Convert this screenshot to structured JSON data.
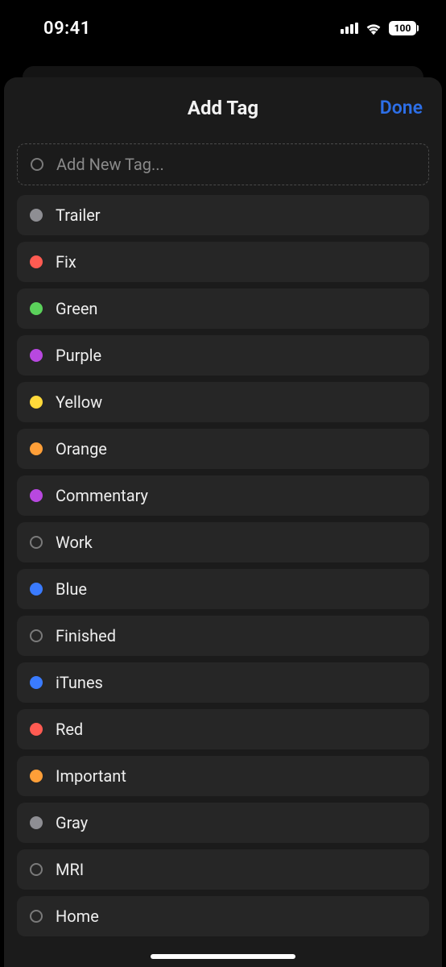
{
  "status": {
    "time": "09:41",
    "battery": "100"
  },
  "header": {
    "title": "Add Tag",
    "done": "Done"
  },
  "add_new": {
    "placeholder": "Add New Tag..."
  },
  "tags": [
    {
      "label": "Trailer",
      "color": "#8e8e93",
      "filled": true
    },
    {
      "label": "Fix",
      "color": "#ff5b52",
      "filled": true
    },
    {
      "label": "Green",
      "color": "#5bd15b",
      "filled": true
    },
    {
      "label": "Purple",
      "color": "#b848e0",
      "filled": true
    },
    {
      "label": "Yellow",
      "color": "#ffd93a",
      "filled": true
    },
    {
      "label": "Orange",
      "color": "#ff9f38",
      "filled": true
    },
    {
      "label": "Commentary",
      "color": "#b848e0",
      "filled": true
    },
    {
      "label": "Work",
      "color": "",
      "filled": false
    },
    {
      "label": "Blue",
      "color": "#3a7bff",
      "filled": true
    },
    {
      "label": "Finished",
      "color": "",
      "filled": false
    },
    {
      "label": "iTunes",
      "color": "#3a7bff",
      "filled": true
    },
    {
      "label": "Red",
      "color": "#ff5b52",
      "filled": true
    },
    {
      "label": "Important",
      "color": "#ff9f38",
      "filled": true
    },
    {
      "label": "Gray",
      "color": "#8e8e93",
      "filled": true
    },
    {
      "label": "MRI",
      "color": "",
      "filled": false
    },
    {
      "label": "Home",
      "color": "",
      "filled": false
    }
  ]
}
